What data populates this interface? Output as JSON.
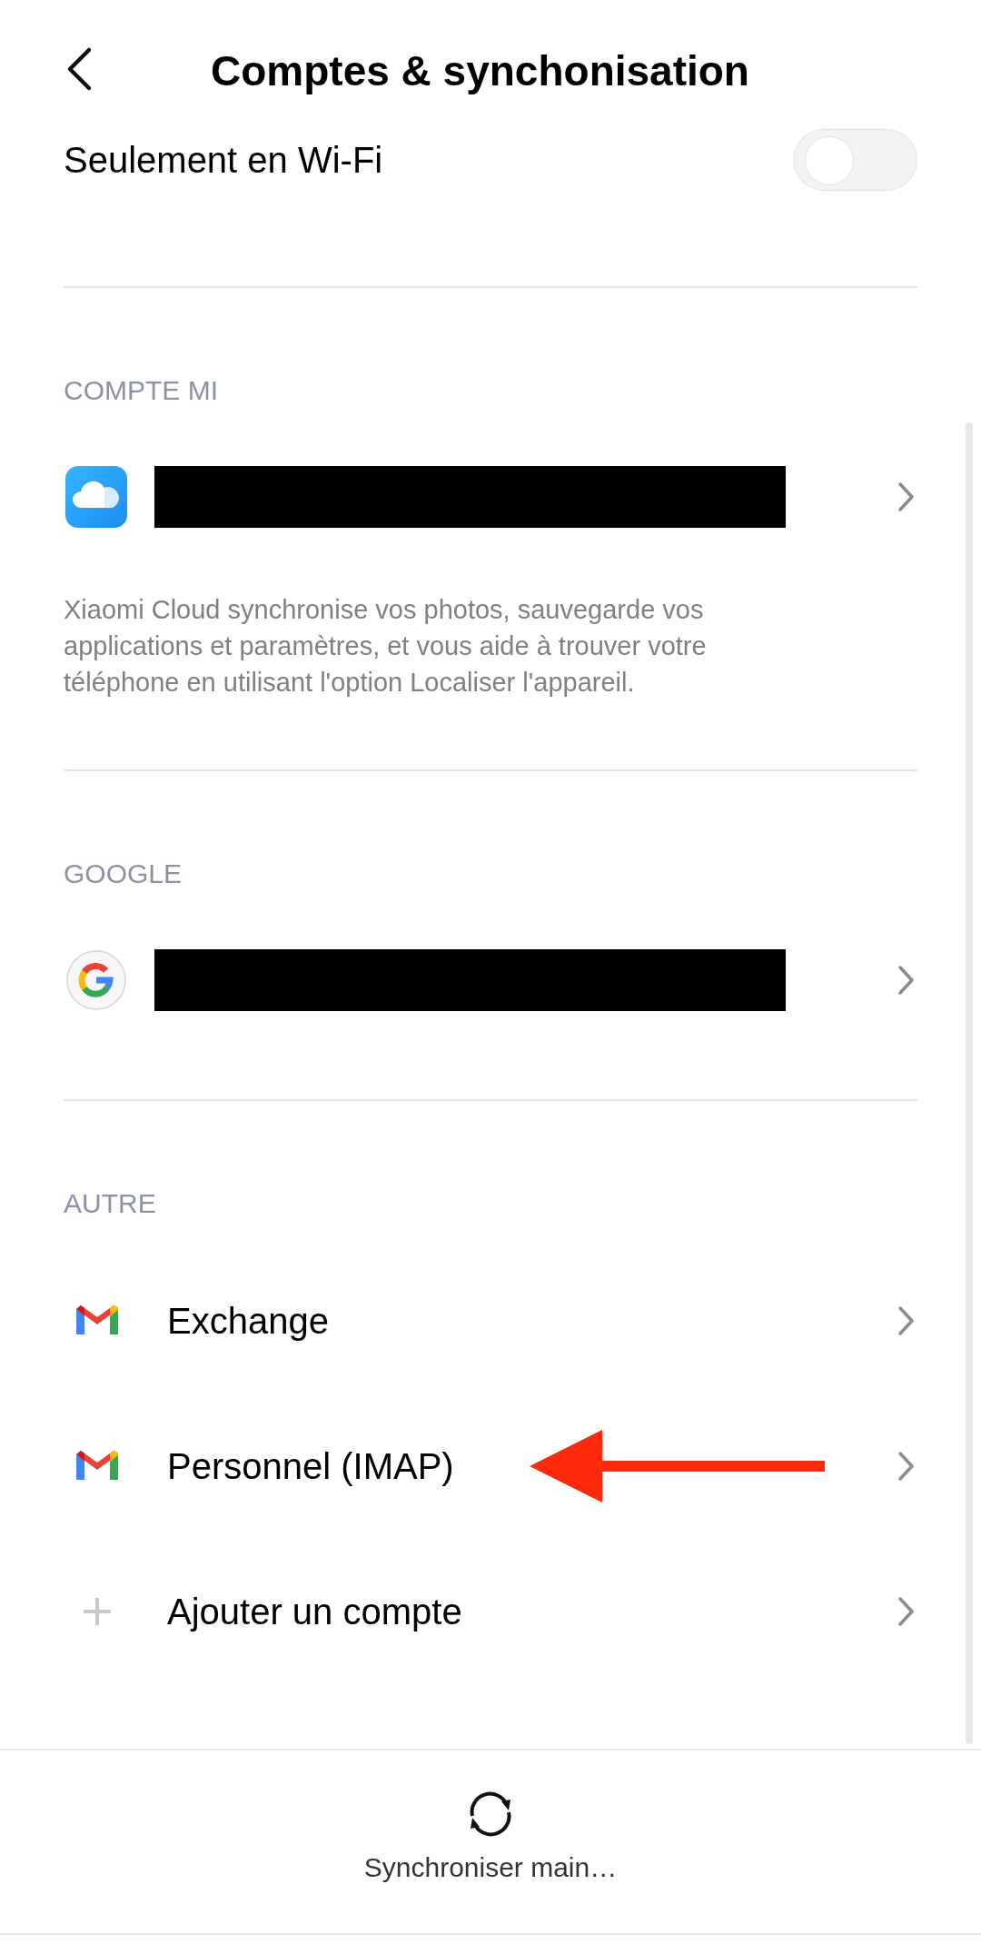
{
  "header": {
    "title": "Comptes & synchonisation"
  },
  "wifi_only": {
    "label": "Seulement en Wi-Fi",
    "on": false
  },
  "sections": [
    {
      "title": "COMPTE MI",
      "items": [
        {
          "kind": "cloud",
          "redacted": true
        }
      ],
      "description": "Xiaomi Cloud synchronise vos photos, sauvegarde vos applications et paramètres, et vous aide à trouver votre téléphone en utilisant l'option Localiser l'appareil."
    },
    {
      "title": "GOOGLE",
      "items": [
        {
          "kind": "google",
          "redacted": true
        }
      ]
    },
    {
      "title": "AUTRE",
      "items": [
        {
          "kind": "mail",
          "label": "Exchange",
          "pointed": false
        },
        {
          "kind": "mail",
          "label": "Personnel (IMAP)",
          "pointed": true
        },
        {
          "kind": "add",
          "label": "Ajouter un compte",
          "pointed": false
        }
      ]
    }
  ],
  "bottom_bar": {
    "label": "Synchroniser main…"
  }
}
